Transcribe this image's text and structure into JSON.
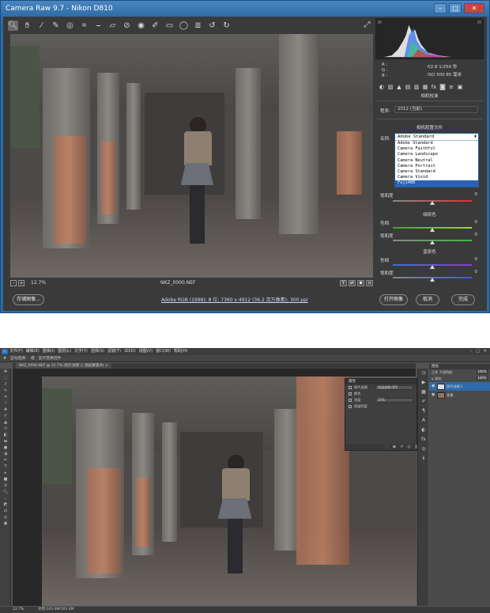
{
  "camera_raw": {
    "title": "Camera Raw 9.7  -  Nikon D810",
    "toolbar_icons": [
      "zoom-icon",
      "hand-icon",
      "white-balance-icon",
      "color-sampler-icon",
      "target-adjust-icon",
      "crop-icon",
      "straighten-icon",
      "transform-icon",
      "spot-removal-icon",
      "red-eye-icon",
      "adjustment-brush-icon",
      "graduated-filter-icon",
      "radial-filter-icon",
      "preferences-icon",
      "rotate-left-icon",
      "rotate-right-icon"
    ],
    "readout": {
      "r": "R :",
      "g": "G :",
      "b": "B :",
      "aperture": "f/2.8   1/250 秒",
      "iso": "ISO 500   85 毫米"
    },
    "panel_title": "相机校准",
    "process_label": "程序:",
    "process_value": "2012 (当前)",
    "profile_heading": "相机配置文件",
    "profile_name_label": "名称:",
    "profile_current": "Adobe Standard",
    "profile_options": [
      "Adobe Standard",
      "Camera Faithful",
      "Camera Landscape",
      "Camera Neutral",
      "Camera Portrait",
      "Camera Standard",
      "Camera Vivid",
      "Fuji400"
    ],
    "profile_selected_index": 7,
    "saturation_label": "饱和度",
    "saturation_value": "0",
    "groups": [
      {
        "title": "绿原色",
        "sliders": [
          {
            "label": "色相",
            "value": "0"
          },
          {
            "label": "饱和度",
            "value": "0"
          }
        ]
      },
      {
        "title": "蓝原色",
        "sliders": [
          {
            "label": "色相",
            "value": "0"
          },
          {
            "label": "饱和度",
            "value": "0"
          }
        ]
      }
    ],
    "zoom_level": "12.7%",
    "filename": "NKZ_0000.NEF",
    "save_button": "存储图像...",
    "info_link": "Adobe RGB (1998); 8 位; 7360 x 4912 (36.2 百万像素); 300 ppi",
    "open_button": "打开图像",
    "cancel_button": "取消",
    "done_button": "完成"
  },
  "photoshop": {
    "menu_items": [
      "文件(F)",
      "编辑(E)",
      "图像(I)",
      "图层(L)",
      "文字(Y)",
      "选择(S)",
      "滤镜(T)",
      "3D(D)",
      "视图(V)",
      "窗口(W)",
      "帮助(H)"
    ],
    "options_items": [
      "自动选择:",
      "组",
      "显示变换控件"
    ],
    "document_tab": "NKZ_0000.NEF @ 12.7% (照片滤镜 1, 图层蒙版/8) ×",
    "properties_title": "属性",
    "properties_rows": [
      {
        "label": "照片滤镜",
        "value": "加温滤镜 (85)"
      },
      {
        "label": "颜色",
        "value": ""
      },
      {
        "label": "浓度",
        "value": "25%"
      },
      {
        "label": "保留明度",
        "value": ""
      }
    ],
    "layers_title": "图层",
    "layers_mode": "正常",
    "layers_opacity_label": "不透明度:",
    "layers_opacity": "100%",
    "layers_fill_label": "填充:",
    "layers_fill": "100%",
    "layers": [
      {
        "name": "照片滤镜 1",
        "selected": true
      },
      {
        "name": "背景",
        "selected": false
      }
    ],
    "status_zoom": "12.7%",
    "status_doc": "文档:103.4M/103.4M"
  }
}
